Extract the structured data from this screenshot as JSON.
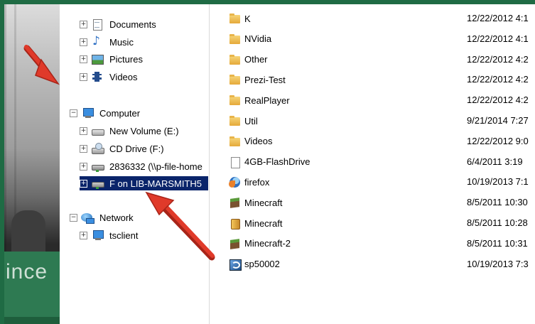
{
  "colors": {
    "frame": "#1f6b44",
    "selected": "#0a246a",
    "arrow": "#e03a2a"
  },
  "photo": {
    "caption": "ince"
  },
  "tree": {
    "documents": "Documents",
    "music": "Music",
    "pictures": "Pictures",
    "videos": "Videos",
    "computer": "Computer",
    "new_volume": "New Volume (E:)",
    "cd_drive": "CD Drive (F:)",
    "share": "2836332 (\\\\p-file-home",
    "f_drive": "F on LIB-MARSMITH5",
    "network": "Network",
    "tsclient": "tsclient",
    "expand": "+",
    "collapse": "−"
  },
  "files": [
    {
      "name": "K",
      "date": "12/22/2012 4:1",
      "icon": "folder-icon"
    },
    {
      "name": "NVidia",
      "date": "12/22/2012 4:1",
      "icon": "folder-icon"
    },
    {
      "name": "Other",
      "date": "12/22/2012 4:2",
      "icon": "folder-icon"
    },
    {
      "name": "Prezi-Test",
      "date": "12/22/2012 4:2",
      "icon": "folder-icon"
    },
    {
      "name": "RealPlayer",
      "date": "12/22/2012 4:2",
      "icon": "folder-icon"
    },
    {
      "name": "Util",
      "date": "9/21/2014 7:27",
      "icon": "folder-icon"
    },
    {
      "name": "Videos",
      "date": "12/22/2012 9:0",
      "icon": "folder-icon"
    },
    {
      "name": "4GB-FlashDrive",
      "date": "6/4/2011 3:19",
      "icon": "file-icon"
    },
    {
      "name": "firefox",
      "date": "10/19/2013 7:1",
      "icon": "firefox-icon"
    },
    {
      "name": "Minecraft",
      "date": "8/5/2011 10:30",
      "icon": "minecraft-icon"
    },
    {
      "name": "Minecraft",
      "date": "8/5/2011 10:28",
      "icon": "jar-icon"
    },
    {
      "name": "Minecraft-2",
      "date": "8/5/2011 10:31",
      "icon": "minecraft-icon"
    },
    {
      "name": "sp50002",
      "date": "10/19/2013 7:3",
      "icon": "setup-icon"
    }
  ]
}
